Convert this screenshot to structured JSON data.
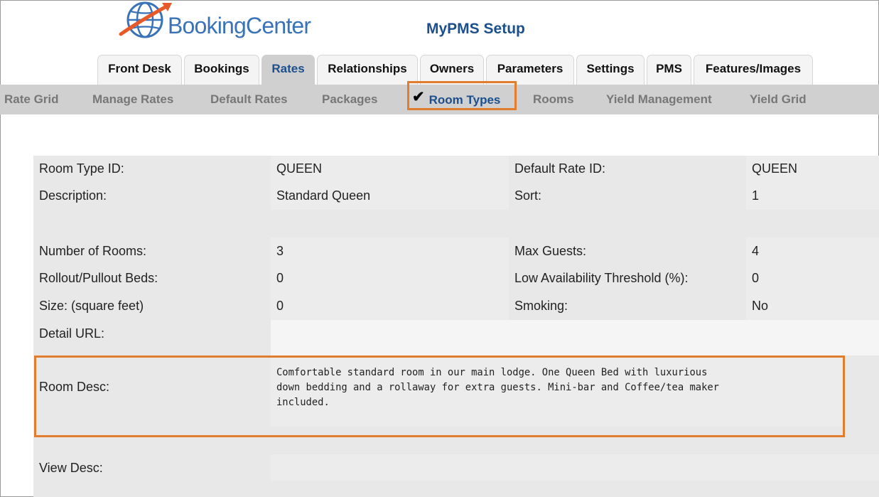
{
  "brand": {
    "name": "BookingCenter"
  },
  "app_title": "MyPMS Setup",
  "main_tabs": [
    "Front Desk",
    "Bookings",
    "Rates",
    "Relationships",
    "Owners",
    "Parameters",
    "Settings",
    "PMS",
    "Features/Images"
  ],
  "active_main_tab": "Rates",
  "sub_nav": [
    "Rate Grid",
    "Manage Rates",
    "Default Rates",
    "Packages",
    "Room Types",
    "Rooms",
    "Yield Management",
    "Yield Grid"
  ],
  "active_sub_nav": "Room Types",
  "form": {
    "room_type_id": {
      "label": "Room Type  ID:",
      "value": "QUEEN"
    },
    "default_rate_id": {
      "label": "Default Rate ID:",
      "value": "QUEEN"
    },
    "description": {
      "label": "Description:",
      "value": "Standard Queen"
    },
    "sort": {
      "label": "Sort:",
      "value": "1"
    },
    "number_of_rooms": {
      "label": "Number of Rooms:",
      "value": "3"
    },
    "max_guests": {
      "label": "Max Guests:",
      "value": "4"
    },
    "rollout_beds": {
      "label": "Rollout/Pullout Beds:",
      "value": "0"
    },
    "low_availability": {
      "label": "Low Availability Threshold (%):",
      "value": "0"
    },
    "size": {
      "label": "Size: (square feet)",
      "value": "0"
    },
    "smoking": {
      "label": "Smoking:",
      "value": "No"
    },
    "detail_url": {
      "label": "Detail URL:",
      "value": ""
    },
    "room_desc": {
      "label": "Room Desc:",
      "lines": [
        "Comfortable standard room in our main lodge. One Queen Bed with luxurious",
        "down bedding and a rollaway for extra guests. Mini-bar and Coffee/tea maker",
        "included."
      ]
    },
    "view_desc": {
      "label": "View Desc:",
      "value": ""
    }
  },
  "colors": {
    "accent_orange": "#e17d2d",
    "brand_blue": "#1c4f8c",
    "logo_swoosh": "#e8592a"
  }
}
